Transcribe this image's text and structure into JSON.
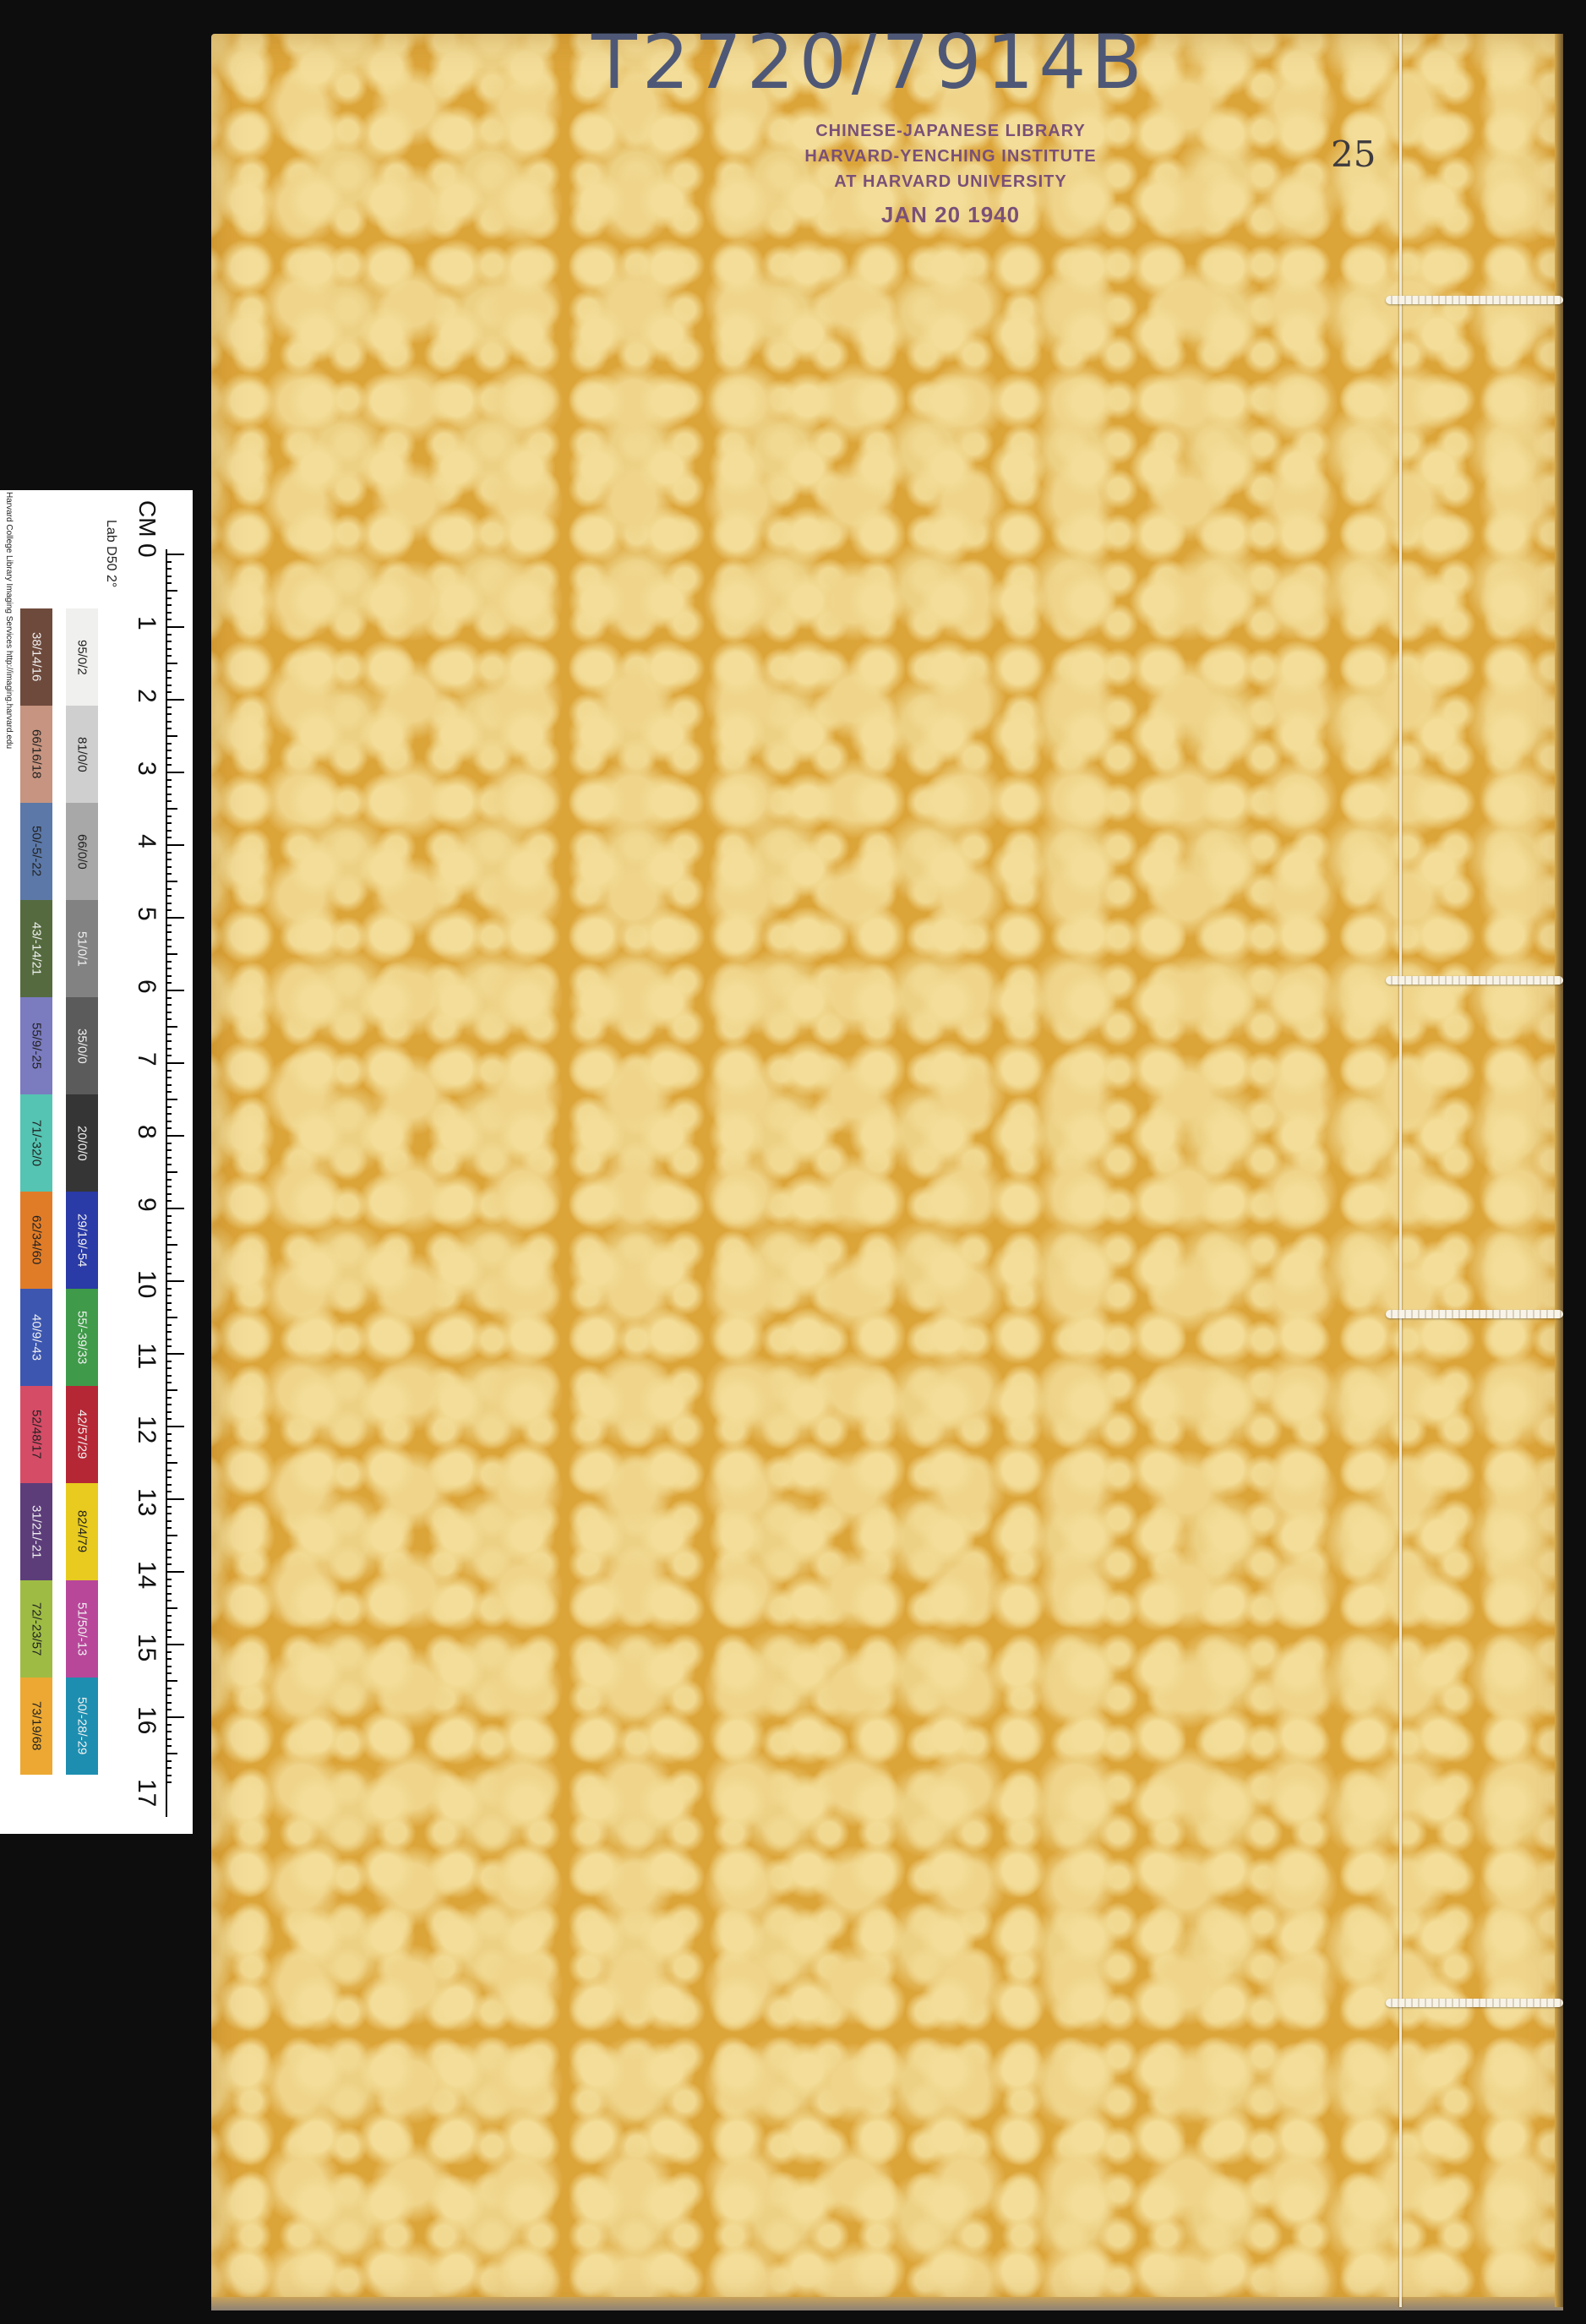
{
  "cover": {
    "call_number": "T2720/7914B",
    "stamp": {
      "line1": "CHINESE-JAPANESE LIBRARY",
      "line2": "HARVARD-YENCHING INSTITUTE",
      "line3": "AT HARVARD UNIVERSITY",
      "date": "JAN 20 1940"
    },
    "volume_number": "25",
    "colors": {
      "paper": "#dca53a",
      "paper_light": "#f2db96",
      "stamp_ink": "#7a5078",
      "ink": "#4e5876"
    }
  },
  "target": {
    "credit": "Harvard College Library Imaging Services http://imaging.harvard.edu",
    "cm_label": "CM",
    "lab_label": "Lab D50 2°",
    "ruler_numbers": [
      "0",
      "1",
      "2",
      "3",
      "4",
      "5",
      "6",
      "7",
      "8",
      "9",
      "10",
      "11",
      "12",
      "13",
      "14",
      "15",
      "16",
      "17"
    ],
    "gray_patches": [
      {
        "label": "95/0/2",
        "color": "#f0f0ee"
      },
      {
        "label": "81/0/0",
        "color": "#cfcfcf"
      },
      {
        "label": "66/0/0",
        "color": "#a8a8a8"
      },
      {
        "label": "51/0/1",
        "color": "#828282"
      },
      {
        "label": "35/0/0",
        "color": "#5b5b5b"
      },
      {
        "label": "20/0/0",
        "color": "#353535"
      },
      {
        "label": "29/19/-54",
        "color": "#2a3aa6"
      },
      {
        "label": "55/-39/33",
        "color": "#3f9a49"
      },
      {
        "label": "42/57/29",
        "color": "#b52735"
      },
      {
        "label": "82/4/79",
        "color": "#e8cb1e"
      },
      {
        "label": "51/50/-13",
        "color": "#b8479a"
      },
      {
        "label": "50/-28/-29",
        "color": "#1d8eb0"
      }
    ],
    "color_patches": [
      {
        "label": "38/14/16",
        "color": "#6e4a3c"
      },
      {
        "label": "66/16/18",
        "color": "#c69480"
      },
      {
        "label": "50/-5/-22",
        "color": "#5b78a8"
      },
      {
        "label": "43/-14/21",
        "color": "#556b3f"
      },
      {
        "label": "55/9/-25",
        "color": "#7b7bc0"
      },
      {
        "label": "71/-32/0",
        "color": "#55c4b2"
      },
      {
        "label": "62/34/60",
        "color": "#e07c28"
      },
      {
        "label": "40/9/-43",
        "color": "#3d57b0"
      },
      {
        "label": "52/48/17",
        "color": "#d54c67"
      },
      {
        "label": "31/21/-21",
        "color": "#5c3d79"
      },
      {
        "label": "72/-23/57",
        "color": "#9ebc44"
      },
      {
        "label": "73/19/68",
        "color": "#eca832"
      }
    ]
  }
}
